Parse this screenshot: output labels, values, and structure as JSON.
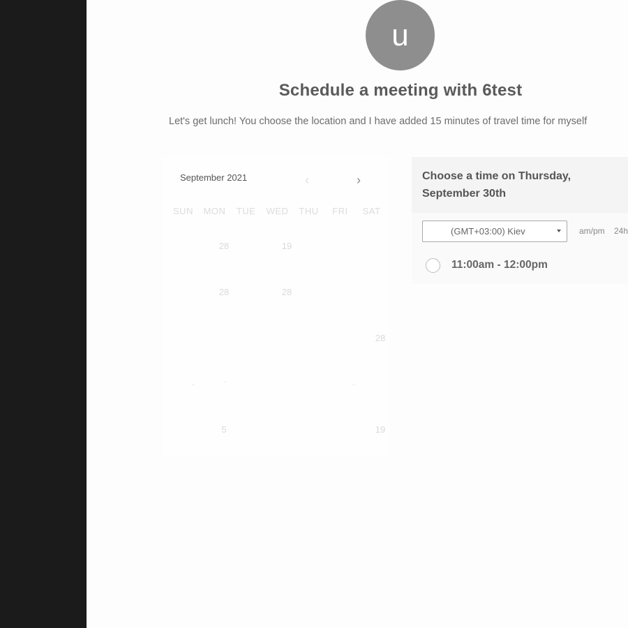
{
  "avatar": {
    "initial": "u"
  },
  "title": "Schedule a meeting with 6test",
  "description": "Let's get lunch! You choose the location and I have added 15 minutes of travel time for myself",
  "calendar": {
    "month_label": "September 2021",
    "prev_icon": "chevron-left-icon",
    "next_icon": "chevron-right-icon",
    "weekdays": [
      "SUN",
      "MON",
      "TUE",
      "WED",
      "THU",
      "FRI",
      "SAT"
    ],
    "cells": {
      "r1_mon": "28",
      "r1_wed": "19",
      "r2_mon": "28",
      "r2_wed": "28",
      "r3_sat": "28",
      "r4_sun": "-",
      "r4_mon": "'",
      "r4_fri": "-",
      "r5_mon": "5",
      "r5_sat": "19"
    }
  },
  "time_panel": {
    "heading": "Choose a time on Thursday, September 30th",
    "timezone": "(GMT+03:00) Kiev",
    "format_ampm": "am/pm",
    "format_24h": "24h",
    "slots": [
      {
        "label": "11:00am - 12:00pm"
      }
    ]
  },
  "colors": {
    "sidebar": "#1b1b1b",
    "avatar": "#8e8e8e",
    "background": "#fdfdfd"
  }
}
